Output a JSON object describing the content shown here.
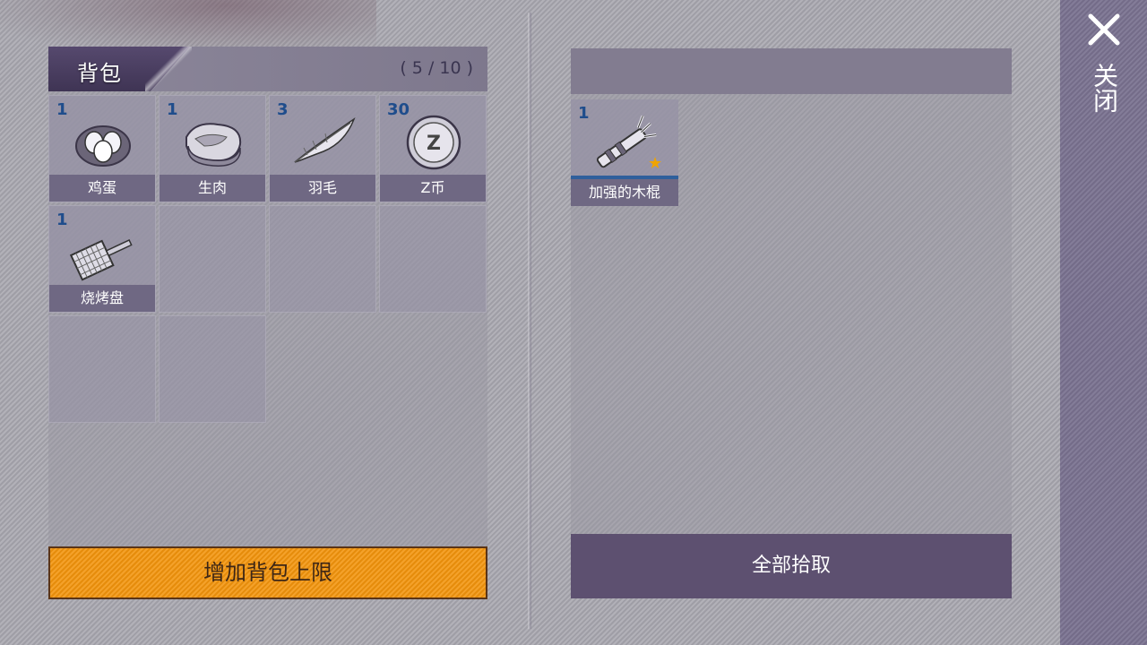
{
  "bag": {
    "title": "背包",
    "capacity": "( 5 / 10 )",
    "items": [
      {
        "count": "1",
        "name": "鸡蛋",
        "icon": "eggs-icon"
      },
      {
        "count": "1",
        "name": "生肉",
        "icon": "raw-meat-icon"
      },
      {
        "count": "3",
        "name": "羽毛",
        "icon": "feather-icon"
      },
      {
        "count": "30",
        "name": "Z币",
        "icon": "z-coin-icon"
      },
      {
        "count": "1",
        "name": "烧烤盘",
        "icon": "grill-pan-icon"
      }
    ],
    "coin_text": "Z",
    "expand_button": "增加背包上限"
  },
  "loot": {
    "items": [
      {
        "count": "1",
        "name": "加强的木棍",
        "icon": "reinforced-stick-icon",
        "star": "★"
      }
    ],
    "collect_all_button": "全部拾取"
  },
  "sidebar": {
    "close_label": "关闭"
  },
  "colors": {
    "expand_button": "#f2940c",
    "count_text": "#1f4d8c",
    "collect_button": "#5d5070",
    "star": "#f0a400"
  }
}
